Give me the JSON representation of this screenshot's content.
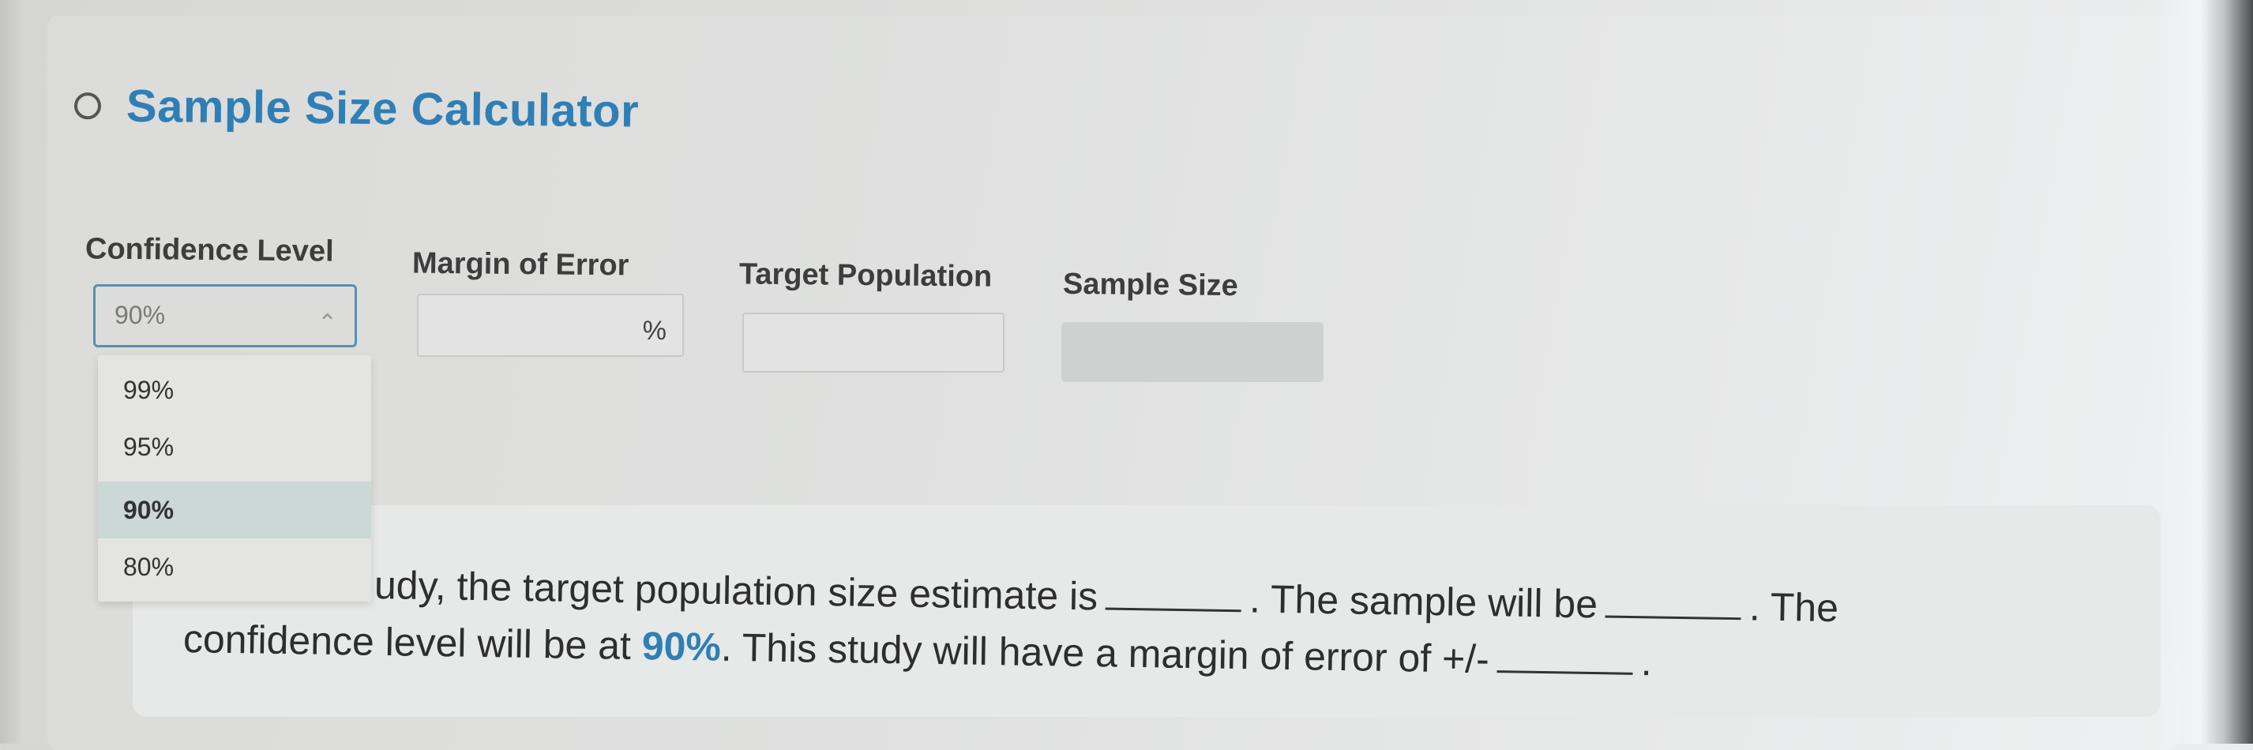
{
  "header": {
    "title": "Sample Size Calculator"
  },
  "fields": {
    "confidence_label": "Confidence Level",
    "confidence_value": "90%",
    "margin_label": "Margin of Error",
    "margin_suffix": "%",
    "target_label": "Target Population",
    "sample_label": "Sample Size"
  },
  "dropdown": {
    "options": [
      "99%",
      "95%",
      "90%",
      "80%"
    ],
    "selected": "90%"
  },
  "statement": {
    "line1_text": "udy, the target population size estimate is",
    "line1_mid": ". The sample will be",
    "line1_end": ". The",
    "line2_start": "confidence level will be at",
    "line2_value": "90%",
    "line2_mid": ". This study will have a margin of error of +/-",
    "line2_end": "."
  },
  "colors": {
    "accent": "#2f7fb6",
    "selected_option": "#cbd8d6"
  }
}
